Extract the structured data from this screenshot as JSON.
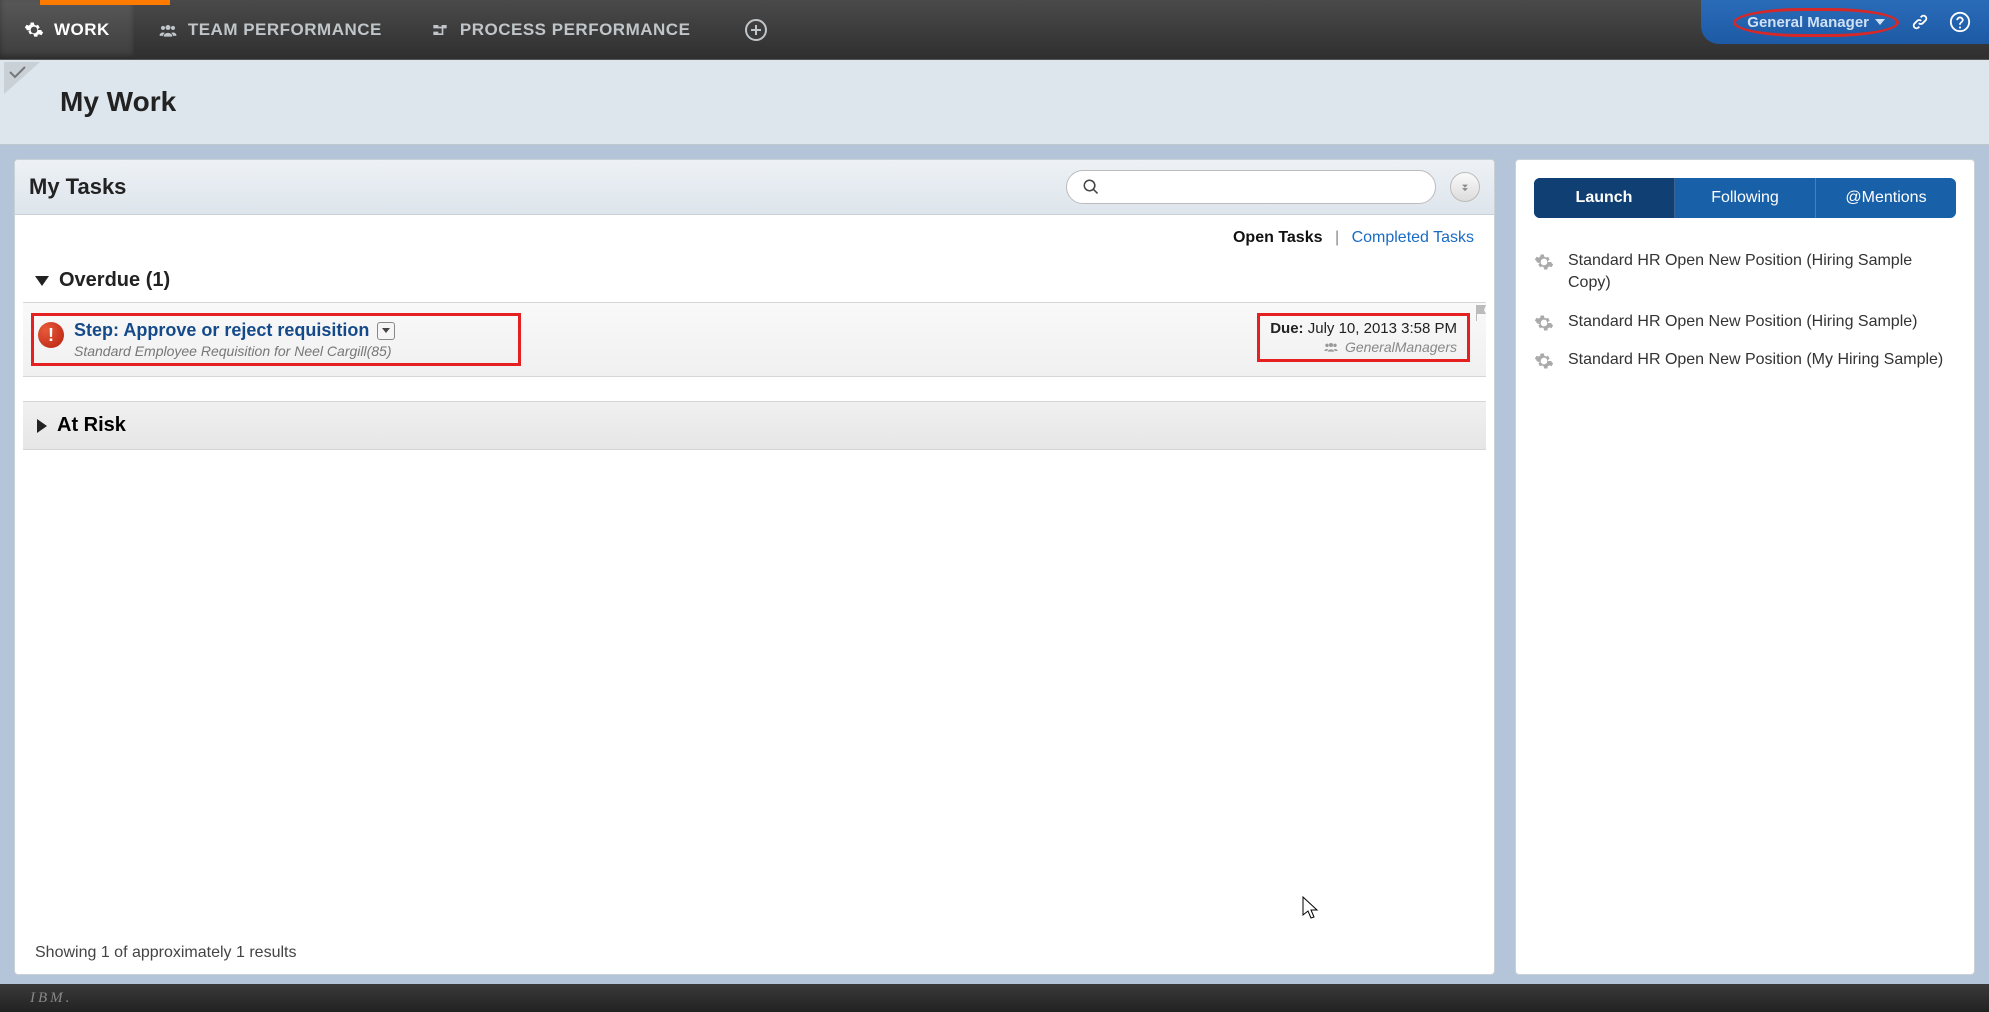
{
  "nav": {
    "work": "WORK",
    "team": "TEAM PERFORMANCE",
    "process": "PROCESS PERFORMANCE"
  },
  "user": {
    "name": "General Manager"
  },
  "page": {
    "title": "My Work"
  },
  "tasks": {
    "title": "My Tasks",
    "search_placeholder": "",
    "filters": {
      "open": "Open Tasks",
      "completed": "Completed Tasks"
    },
    "overdue": {
      "header": "Overdue (1)",
      "item": {
        "title": "Step: Approve or reject requisition",
        "subtitle": "Standard Employee Requisition for Neel Cargill(85)",
        "due_label": "Due:",
        "due_value": "July 10, 2013 3:58 PM",
        "assignee": "GeneralManagers"
      }
    },
    "atrisk": {
      "header": "At Risk"
    },
    "results": "Showing 1 of approximately 1 results"
  },
  "sidebar": {
    "tabs": {
      "launch": "Launch",
      "following": "Following",
      "mentions": "@Mentions"
    },
    "items": [
      "Standard HR Open New Position (Hiring Sample Copy)",
      "Standard HR Open New Position (Hiring Sample)",
      "Standard HR Open New Position (My Hiring Sample)"
    ]
  },
  "footer": {
    "brand": "IBM."
  }
}
